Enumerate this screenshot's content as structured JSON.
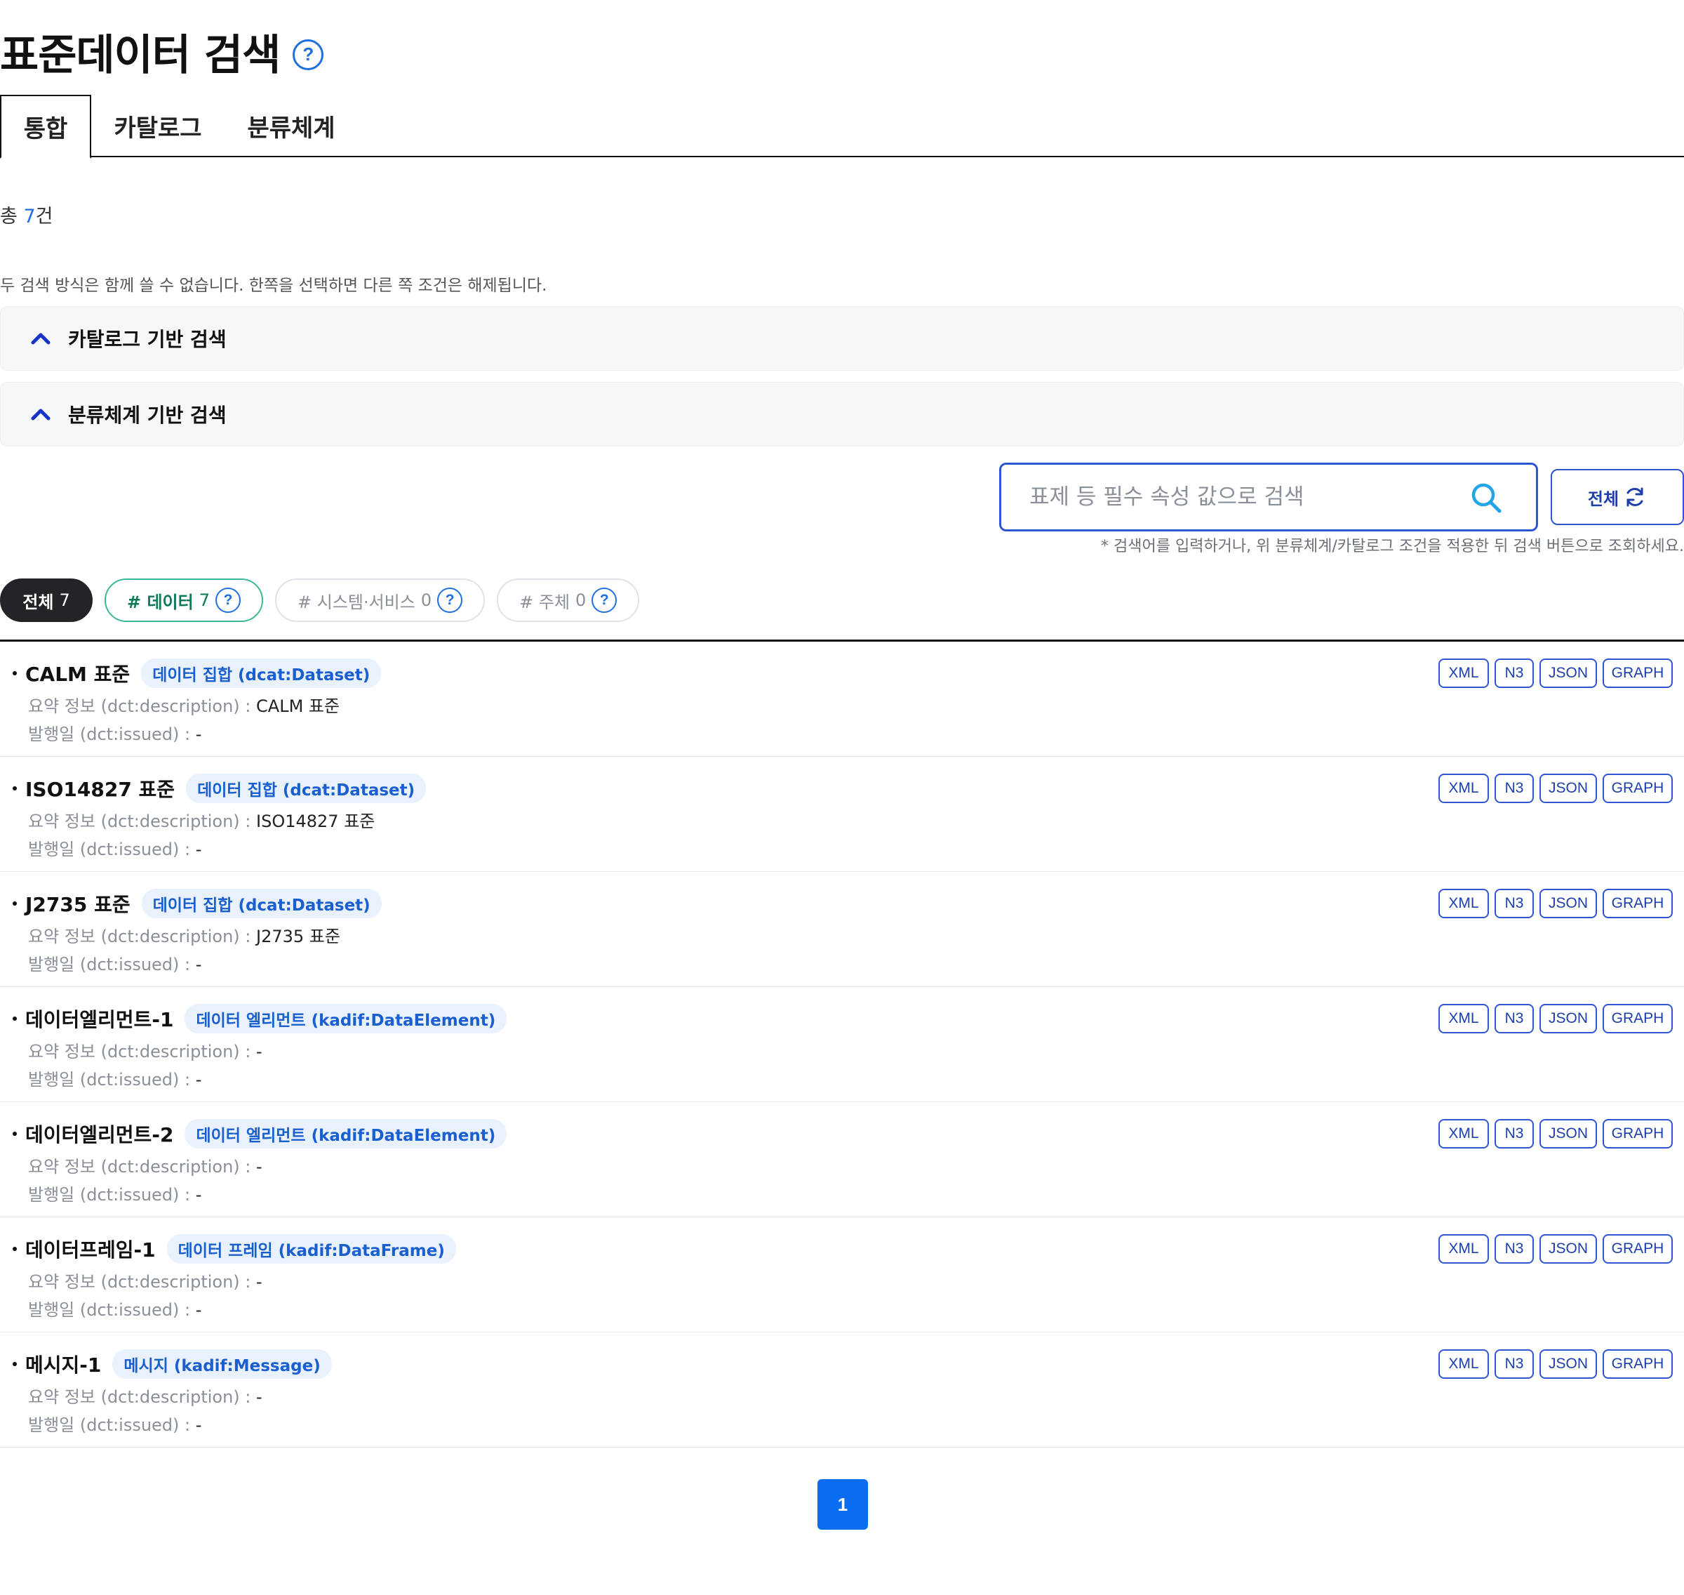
{
  "header": {
    "title": "표준데이터 검색",
    "help": "?"
  },
  "tabs": [
    "통합",
    "카탈로그",
    "분류체계"
  ],
  "summary": {
    "prefix": "총 ",
    "count": "7",
    "suffix": "건"
  },
  "notice": "두 검색 방식은 함께 쓸 수 없습니다. 한쪽을 선택하면 다른 쪽 조건은 해제됩니다.",
  "accordions": [
    "카탈로그 기반 검색",
    "분류체계 기반 검색"
  ],
  "search": {
    "placeholder": "표제 등 필수 속성 값으로 검색",
    "value": "",
    "reset_label": "전체",
    "hint": "* 검색어를 입력하거나, 위 분류체계/카탈로그 조건을 적용한 뒤 검색 버튼으로 조회하세요."
  },
  "filters": [
    {
      "label": "전체",
      "count": "7"
    },
    {
      "label": "# 데이터",
      "count": "7",
      "help": "?"
    },
    {
      "label": "# 시스템·서비스",
      "count": "0",
      "help": "?"
    },
    {
      "label": "# 주체",
      "count": "0",
      "help": "?"
    }
  ],
  "meta_labels": {
    "description": "요약 정보 (dct:description) : ",
    "issued": "발행일 (dct:issued) : "
  },
  "formats": [
    "XML",
    "N3",
    "JSON",
    "GRAPH"
  ],
  "results": [
    {
      "title": "CALM 표준",
      "type": "데이터 집합 (dcat:Dataset)",
      "description": "CALM 표준",
      "issued": "-"
    },
    {
      "title": "ISO14827 표준",
      "type": "데이터 집합 (dcat:Dataset)",
      "description": "ISO14827 표준",
      "issued": "-"
    },
    {
      "title": "J2735 표준",
      "type": "데이터 집합 (dcat:Dataset)",
      "description": "J2735 표준",
      "issued": "-"
    },
    {
      "title": "데이터엘리먼트-1",
      "type": "데이터 엘리먼트 (kadif:DataElement)",
      "description": "-",
      "issued": "-"
    },
    {
      "title": "데이터엘리먼트-2",
      "type": "데이터 엘리먼트 (kadif:DataElement)",
      "description": "-",
      "issued": "-"
    },
    {
      "title": "데이터프레임-1",
      "type": "데이터 프레임 (kadif:DataFrame)",
      "description": "-",
      "issued": "-"
    },
    {
      "title": "메시지-1",
      "type": "메시지 (kadif:Message)",
      "description": "-",
      "issued": "-"
    }
  ],
  "pagination": {
    "current": "1"
  },
  "colors": {
    "accent": "#1f6fe0",
    "primary_button": "#0a6cf0",
    "border_blue": "#2f55d4",
    "data_chip": "#3bb896"
  },
  "icons": {
    "search": "search-icon",
    "refresh": "refresh-icon",
    "chevron": "chevron-up-icon",
    "help": "question-circle-icon"
  }
}
